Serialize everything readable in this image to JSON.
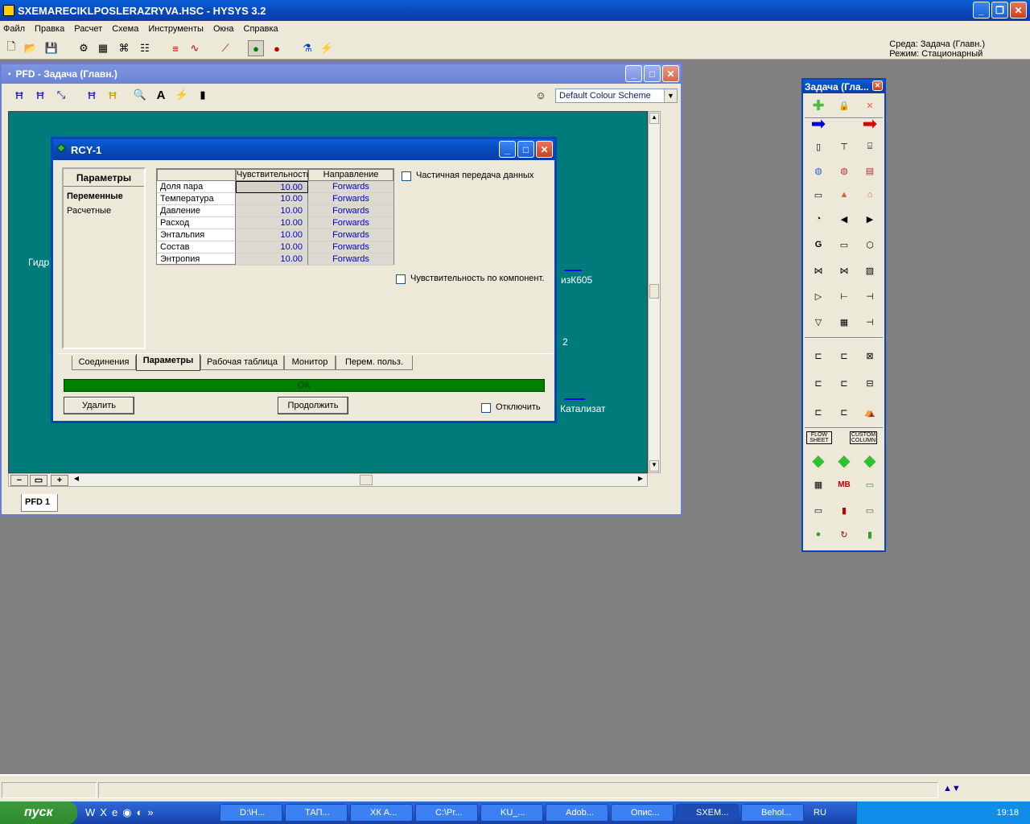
{
  "app": {
    "title": "SXEMARECIKLPOSLERAZRYVA.HSC - HYSYS 3.2",
    "menu": [
      "Файл",
      "Правка",
      "Расчет",
      "Схема",
      "Инструменты",
      "Окна",
      "Справка"
    ],
    "env_line1": "Среда: Задача (Главн.)",
    "env_line2": "Режим: Стационарный"
  },
  "pfd": {
    "title": "PFD - Задача (Главн.)",
    "colour_scheme": "Default Colour Scheme",
    "tab": "PFD 1",
    "labels": {
      "gidr": "Гидр",
      "izk605": "изК605",
      "two": "2",
      "katalizat": "Катализат"
    }
  },
  "rcy": {
    "title": "RCY-1",
    "left_panel": {
      "header": "Параметры",
      "items": [
        "Переменные",
        "Расчетные"
      ]
    },
    "grid": {
      "headers": [
        "Чувствительность",
        "Направление"
      ],
      "rows": [
        {
          "name": "Доля пара",
          "sens": "10.00",
          "dir": "Forwards"
        },
        {
          "name": "Температура",
          "sens": "10.00",
          "dir": "Forwards"
        },
        {
          "name": "Давление",
          "sens": "10.00",
          "dir": "Forwards"
        },
        {
          "name": "Расход",
          "sens": "10.00",
          "dir": "Forwards"
        },
        {
          "name": "Энтальпия",
          "sens": "10.00",
          "dir": "Forwards"
        },
        {
          "name": "Состав",
          "sens": "10.00",
          "dir": "Forwards"
        },
        {
          "name": "Энтропия",
          "sens": "10.00",
          "dir": "Forwards"
        }
      ]
    },
    "partial_transfer": "Частичная передача данных",
    "comp_sensitivity": "Чувствительность по компонент.",
    "tabs": [
      "Соединения",
      "Параметры",
      "Рабочая таблица",
      "Монитор",
      "Перем. польз."
    ],
    "status": "OK",
    "delete_btn": "Удалить",
    "continue_btn": "Продолжить",
    "ignore_label": "Отключить"
  },
  "palette": {
    "title": "Задача (Гла...",
    "flowsheet": "FLOW SHEET",
    "custom_column": "CUSTOM COLUMN"
  },
  "taskbar": {
    "start": "пуск",
    "tasks": [
      "D:\\Н...",
      "ТАП...",
      "ХК А...",
      "C:\\Pr...",
      "KU_...",
      "Adob...",
      "Опис...",
      "SXEM...",
      "Behol..."
    ],
    "lang": "RU",
    "clock": "19:18"
  }
}
